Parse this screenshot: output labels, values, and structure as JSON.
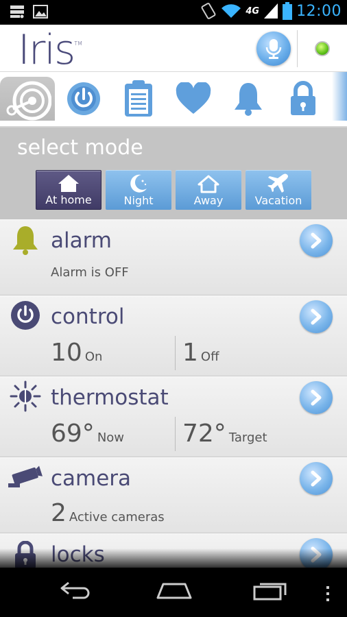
{
  "status_bar": {
    "network_label": "4G",
    "time": "12:00"
  },
  "header": {
    "logo_text": "Iris",
    "logo_tm": "TM"
  },
  "tabs": [
    {
      "name": "dashboard",
      "icon": "radar-icon",
      "active": true
    },
    {
      "name": "control",
      "icon": "power-icon",
      "active": false
    },
    {
      "name": "history",
      "icon": "clipboard-icon",
      "active": false
    },
    {
      "name": "health",
      "icon": "heart-icon",
      "active": false
    },
    {
      "name": "alarm",
      "icon": "bell-icon",
      "active": false
    },
    {
      "name": "locks",
      "icon": "lock-icon",
      "active": false
    }
  ],
  "mode": {
    "title": "select mode",
    "buttons": [
      {
        "label": "At home",
        "icon": "home-icon",
        "selected": true
      },
      {
        "label": "Night",
        "icon": "moon-icon",
        "selected": false
      },
      {
        "label": "Away",
        "icon": "house-outline-icon",
        "selected": false
      },
      {
        "label": "Vacation",
        "icon": "airplane-icon",
        "selected": false
      }
    ]
  },
  "cards": {
    "alarm": {
      "title": "alarm",
      "status": "Alarm is OFF"
    },
    "control": {
      "title": "control",
      "on_value": "10",
      "on_label": "On",
      "off_value": "1",
      "off_label": "Off"
    },
    "thermostat": {
      "title": "thermostat",
      "now_value": "69°",
      "now_label": "Now",
      "target_value": "72°",
      "target_label": "Target"
    },
    "camera": {
      "title": "camera",
      "active_value": "2",
      "active_label": "Active cameras"
    },
    "locks": {
      "title": "locks"
    }
  },
  "colors": {
    "accent_blue": "#5b9bd6",
    "brand_purple": "#4a4a75",
    "selected_mode": "#403b66",
    "status_online": "#5fc21a",
    "clock": "#3ab4ff"
  }
}
